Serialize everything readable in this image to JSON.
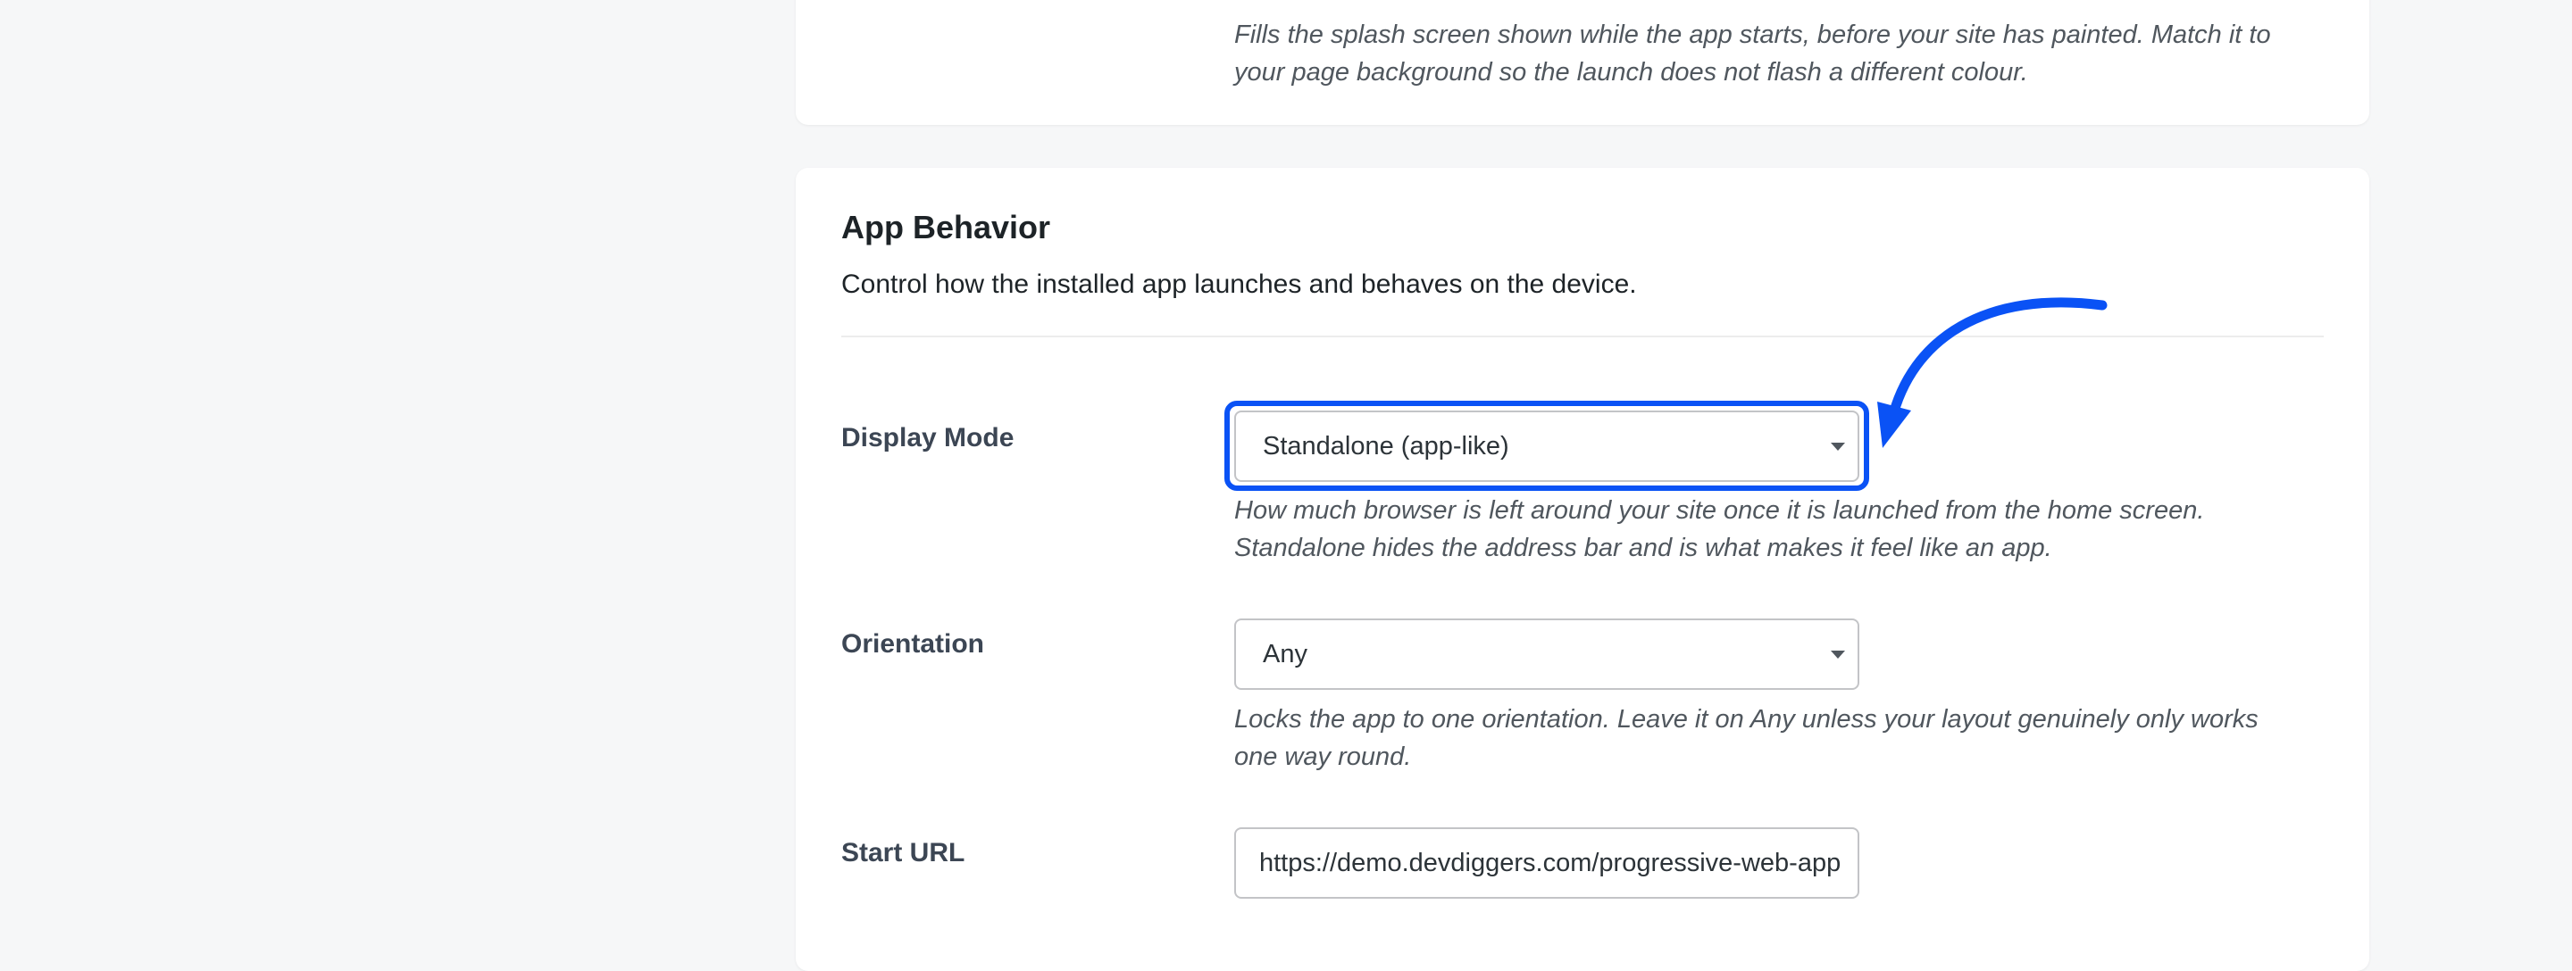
{
  "splash_section": {
    "description": "Fills the splash screen shown while the app starts, before your site has painted. Match it to your page background so the launch does not flash a different colour."
  },
  "app_behavior": {
    "title": "App Behavior",
    "subtitle": "Control how the installed app launches and behaves on the device.",
    "display_mode": {
      "label": "Display Mode",
      "selected": "Standalone (app-like)",
      "help": "How much browser is left around your site once it is launched from the home screen. Standalone hides the address bar and is what makes it feel like an app."
    },
    "orientation": {
      "label": "Orientation",
      "selected": "Any",
      "help": "Locks the app to one orientation. Leave it on Any unless your layout genuinely only works one way round."
    },
    "start_url": {
      "label": "Start URL",
      "value": "https://demo.devdiggers.com/progressive-web-app"
    }
  },
  "colors": {
    "highlight": "#0a52f5",
    "background": "#f6f7f8",
    "card": "#ffffff"
  }
}
